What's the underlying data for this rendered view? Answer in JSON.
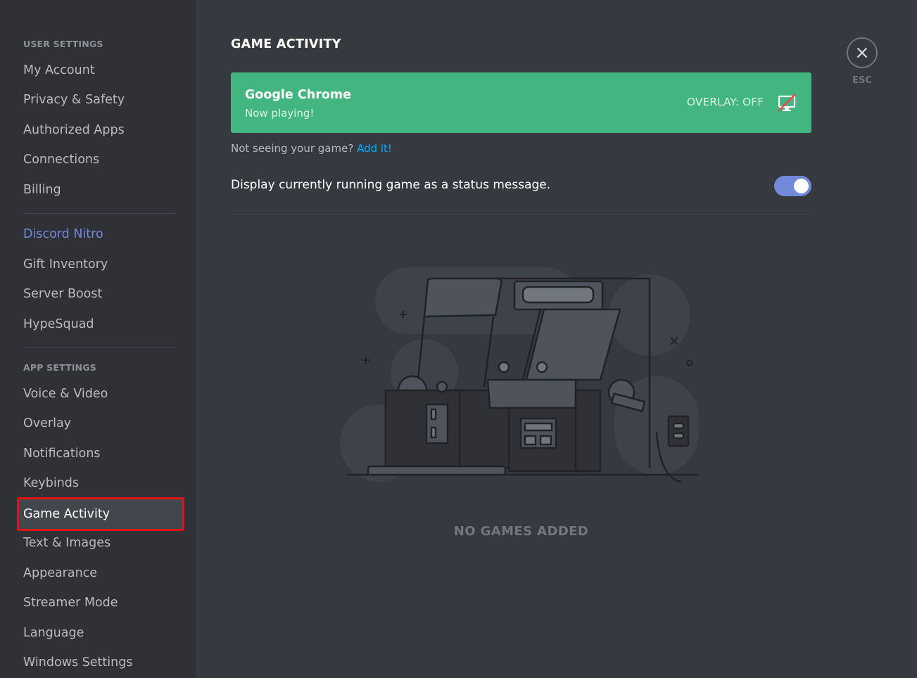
{
  "sidebar": {
    "user_settings_header": "USER SETTINGS",
    "app_settings_header": "APP SETTINGS",
    "items": [
      {
        "label": "My Account"
      },
      {
        "label": "Privacy & Safety"
      },
      {
        "label": "Authorized Apps"
      },
      {
        "label": "Connections"
      },
      {
        "label": "Billing"
      },
      {
        "label": "Discord Nitro"
      },
      {
        "label": "Gift Inventory"
      },
      {
        "label": "Server Boost"
      },
      {
        "label": "HypeSquad"
      },
      {
        "label": "Voice & Video"
      },
      {
        "label": "Overlay"
      },
      {
        "label": "Notifications"
      },
      {
        "label": "Keybinds"
      },
      {
        "label": "Game Activity"
      },
      {
        "label": "Text & Images"
      },
      {
        "label": "Appearance"
      },
      {
        "label": "Streamer Mode"
      },
      {
        "label": "Language"
      },
      {
        "label": "Windows Settings"
      }
    ],
    "selected": "Game Activity"
  },
  "main": {
    "title": "GAME ACTIVITY",
    "current_game": {
      "name": "Google Chrome",
      "status": "Now playing!",
      "overlay_label": "OVERLAY: OFF",
      "overlay_icon": "monitor-off-icon"
    },
    "hint_text": "Not seeing your game?",
    "hint_link": "Add it!",
    "toggle_label": "Display currently running game as a status message.",
    "toggle_on": true,
    "empty_state": "NO GAMES ADDED"
  },
  "close": {
    "icon": "close-icon",
    "label": "ESC"
  },
  "colors": {
    "background": "#36393f",
    "sidebar": "#2f3136",
    "green": "#43b581",
    "blurple": "#7289da",
    "link": "#00b0f4",
    "selection_outline": "#e01414"
  }
}
